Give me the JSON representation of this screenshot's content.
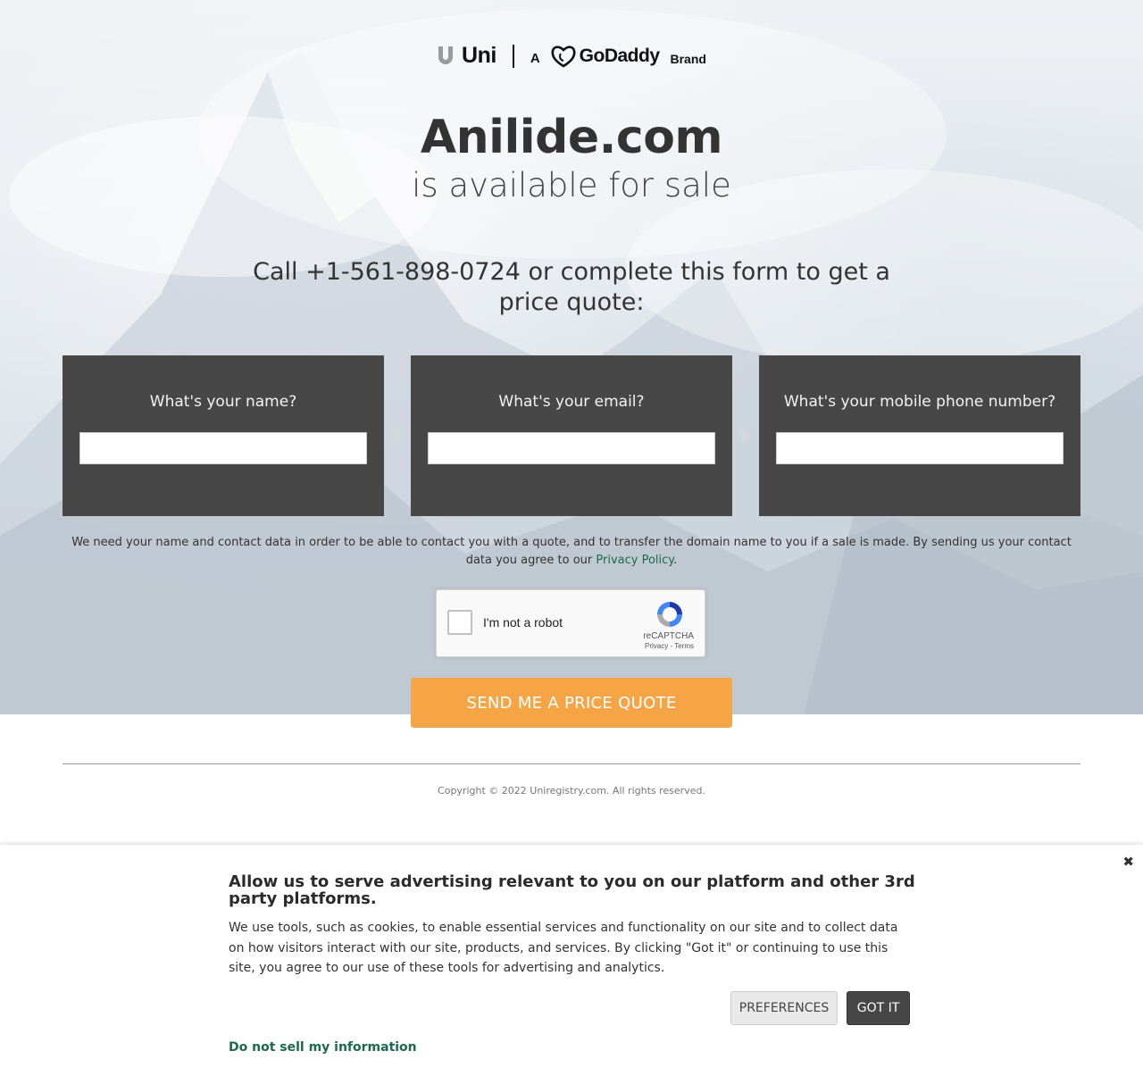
{
  "header": {
    "uni_text": "Uni",
    "a_text": "A",
    "godaddy_text": "GoDaddy",
    "brand_text": "Brand"
  },
  "hero": {
    "domain": "Anilide.com",
    "subtitle": "is available for sale",
    "call_line": "Call +1-561-898-0724 or complete this form to get a price quote:"
  },
  "form": {
    "name_label": "What's your name?",
    "email_label": "What's your email?",
    "phone_label": "What's your mobile phone number?",
    "name_value": "",
    "email_value": "",
    "phone_value": "",
    "disclaimer_pre": "We need your name and contact data in order to be able to contact you with a quote, and to transfer the domain name to you if a sale is made. By sending us your contact data you agree to our ",
    "privacy_link": "Privacy Policy",
    "disclaimer_post": ".",
    "recaptcha_label": "I'm not a robot",
    "recaptcha_brand": "reCAPTCHA",
    "recaptcha_links": "Privacy - Terms",
    "submit_label": "SEND ME A PRICE QUOTE"
  },
  "footer": {
    "copyright": "Copyright © 2022 Uniregistry.com. All rights reserved."
  },
  "consent": {
    "title": "Allow us to serve advertising relevant to you on our platform and other 3rd party platforms.",
    "body": "We use tools, such as cookies, to enable essential services and functionality on our site and to collect data on how visitors interact with our site, products, and services. By clicking \"Got it\" or continuing to use this site, you agree to our use of these tools for advertising and analytics.",
    "preferences_label": "PREFERENCES",
    "got_it_label": "GOT IT",
    "do_not_sell_label": "Do not sell my information",
    "close_glyph": "✖"
  },
  "colors": {
    "accent_button": "#f5a446",
    "form_box": "#474747",
    "link_green": "#1a6b4c"
  }
}
